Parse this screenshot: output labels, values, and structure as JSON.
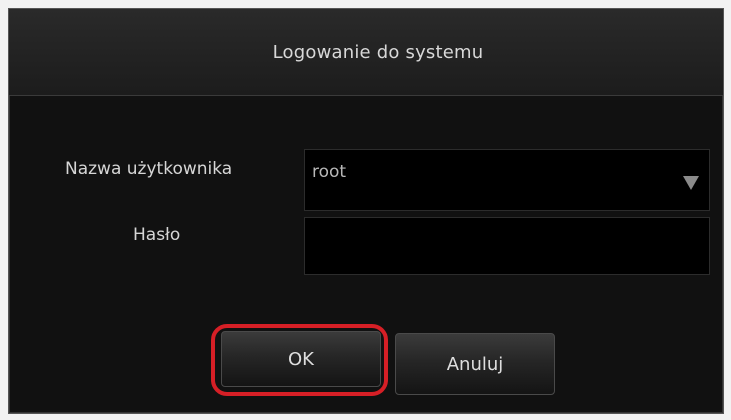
{
  "dialog": {
    "title": "Logowanie do systemu"
  },
  "form": {
    "username_label": "Nazwa użytkownika",
    "username_value": "root",
    "password_label": "Hasło",
    "password_value": ""
  },
  "buttons": {
    "ok_label": "OK",
    "cancel_label": "Anuluj"
  },
  "colors": {
    "dialog_bg": "#111111",
    "highlight_ring": "#d61f26",
    "text": "#d6d6d6"
  },
  "icons": {
    "dropdown": "chevron-down-icon"
  }
}
